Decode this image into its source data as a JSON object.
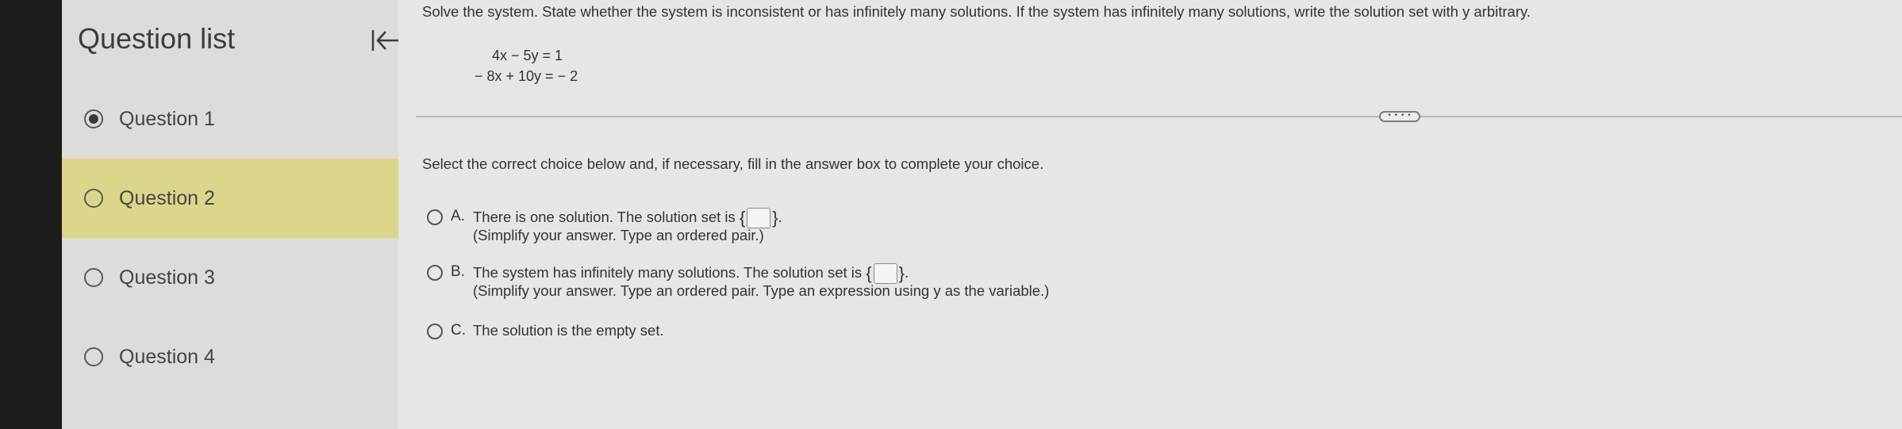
{
  "sidebar": {
    "title": "Question list",
    "items": [
      {
        "label": "Question 1",
        "checked": true,
        "active": false
      },
      {
        "label": "Question 2",
        "checked": false,
        "active": true
      },
      {
        "label": "Question 3",
        "checked": false,
        "active": false
      },
      {
        "label": "Question 4",
        "checked": false,
        "active": false
      }
    ]
  },
  "question": {
    "prompt": "Solve the system. State whether the system is inconsistent or has infinitely many solutions. If the system has infinitely many solutions, write the solution set with y arbitrary.",
    "equations": [
      "4x − 5y = 1",
      "− 8x + 10y = − 2"
    ],
    "instruction": "Select the correct choice below and, if necessary, fill in the answer box to complete your choice.",
    "choices": [
      {
        "letter": "A.",
        "text": "There is one solution. The solution set is",
        "sub": "(Simplify your answer. Type an ordered pair.)"
      },
      {
        "letter": "B.",
        "text": "The system has infinitely many solutions. The solution set is",
        "sub": "(Simplify your answer. Type an ordered pair. Type an expression using y as the variable.)"
      },
      {
        "letter": "C.",
        "text": "The solution is the empty set.",
        "sub": ""
      }
    ]
  },
  "more_button": "• • • •",
  "colors": {
    "active_item": "#dcd68a",
    "sidebar_bg": "#dcdcd8",
    "main_bg": "#e6e6e3"
  }
}
